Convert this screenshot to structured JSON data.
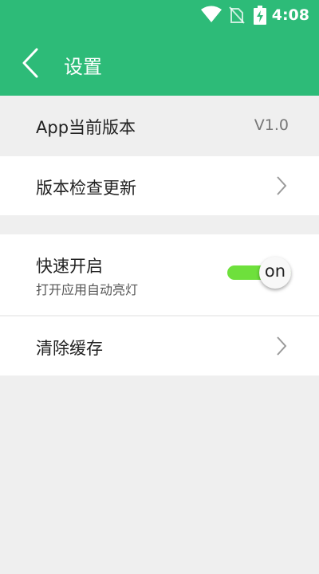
{
  "status_bar": {
    "time": "4:08",
    "icons": [
      "wifi-icon",
      "no-sim-icon",
      "battery-charging-icon"
    ]
  },
  "header": {
    "title": "设置",
    "back_icon": "chevron-left-icon"
  },
  "settings": {
    "version": {
      "label": "App当前版本",
      "value": "V1.0"
    },
    "update": {
      "label": "版本检查更新",
      "icon": "chevron-right-icon"
    },
    "quick_start": {
      "label": "快速开启",
      "sublabel": "打开应用自动亮灯",
      "toggle": {
        "state_label": "on",
        "checked": true
      }
    },
    "clear_cache": {
      "label": "清除缓存",
      "icon": "chevron-right-icon"
    }
  },
  "colors": {
    "primary": "#2dbb78",
    "toggle_on": "#6ee03c",
    "background": "#efefef"
  }
}
